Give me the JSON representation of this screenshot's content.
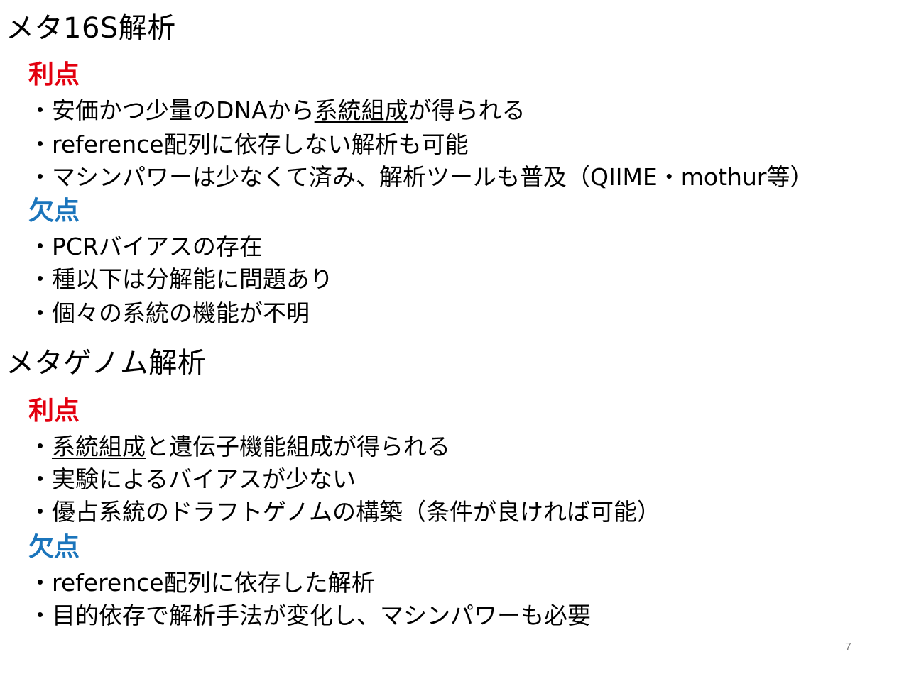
{
  "colors": {
    "text": "#000000",
    "advantage": "#e3000f",
    "disadvantage": "#1b75bc",
    "page_number": "#7f7f7f"
  },
  "section1": {
    "title": "メタ16S解析",
    "advantages_label": "利点",
    "adv1": {
      "pre": "・安価かつ少量のDNAから",
      "u": "系統組成",
      "post": "が得られる"
    },
    "adv2": "・reference配列に依存しない解析も可能",
    "adv3": "・マシンパワーは少なくて済み、解析ツールも普及（QIIME・mothur等）",
    "disadvantages_label": "欠点",
    "dis1": "・PCRバイアスの存在",
    "dis2": "・種以下は分解能に問題あり",
    "dis3": "・個々の系統の機能が不明"
  },
  "section2": {
    "title": "メタゲノム解析",
    "advantages_label": "利点",
    "adv1": {
      "pre": "・",
      "u": "系統組成",
      "post": "と遺伝子機能組成が得られる"
    },
    "adv2": "・実験によるバイアスが少ない",
    "adv3": "・優占系統のドラフトゲノムの構築（条件が良ければ可能）",
    "disadvantages_label": "欠点",
    "dis1": "・reference配列に依存した解析",
    "dis2": "・目的依存で解析手法が変化し、マシンパワーも必要"
  },
  "page_number": "7"
}
